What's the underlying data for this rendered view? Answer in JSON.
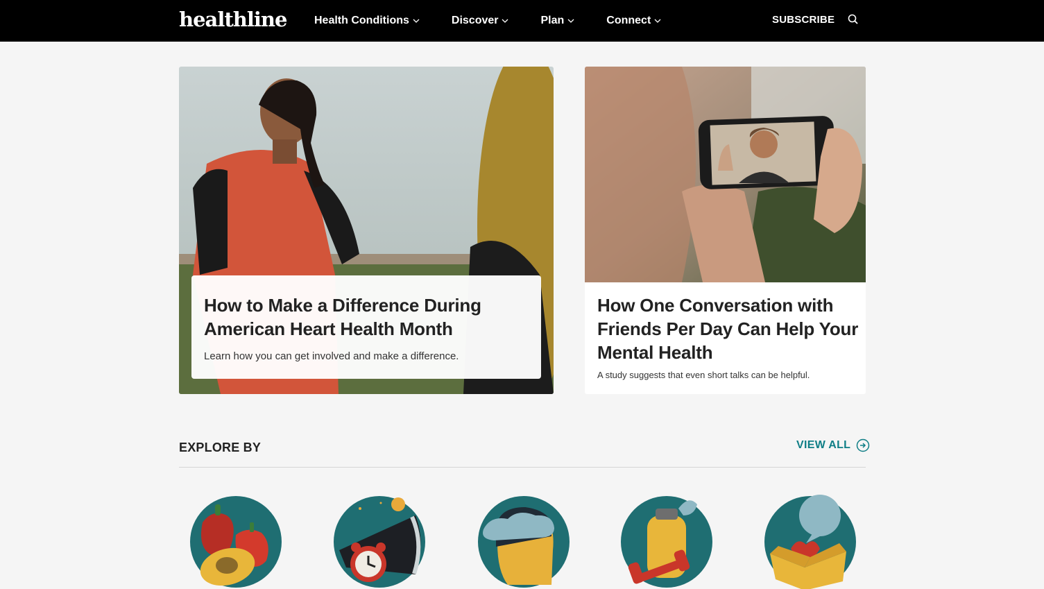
{
  "header": {
    "logo": "healthline",
    "nav": [
      {
        "label": "Health Conditions"
      },
      {
        "label": "Discover"
      },
      {
        "label": "Plan"
      },
      {
        "label": "Connect"
      }
    ],
    "subscribe_label": "SUBSCRIBE",
    "search_icon": "search-icon"
  },
  "featured": [
    {
      "title": "How to Make a Difference During American Heart Health Month",
      "description": "Learn how you can get involved and make a difference."
    },
    {
      "title": "How One Conversation with Friends Per Day Can Help Your Mental Health",
      "description": "A study suggests that even short talks can be helpful."
    }
  ],
  "explore": {
    "title": "EXPLORE BY",
    "view_all_label": "VIEW ALL",
    "items": [
      {
        "icon": "nutrition-icon"
      },
      {
        "icon": "sleep-icon"
      },
      {
        "icon": "mental-health-icon"
      },
      {
        "icon": "fitness-icon"
      },
      {
        "icon": "relationships-icon"
      }
    ]
  },
  "colors": {
    "accent": "#0f7e86",
    "header_bg": "#000000",
    "page_bg": "#f5f5f5",
    "icon_teal": "#1f6e72"
  }
}
